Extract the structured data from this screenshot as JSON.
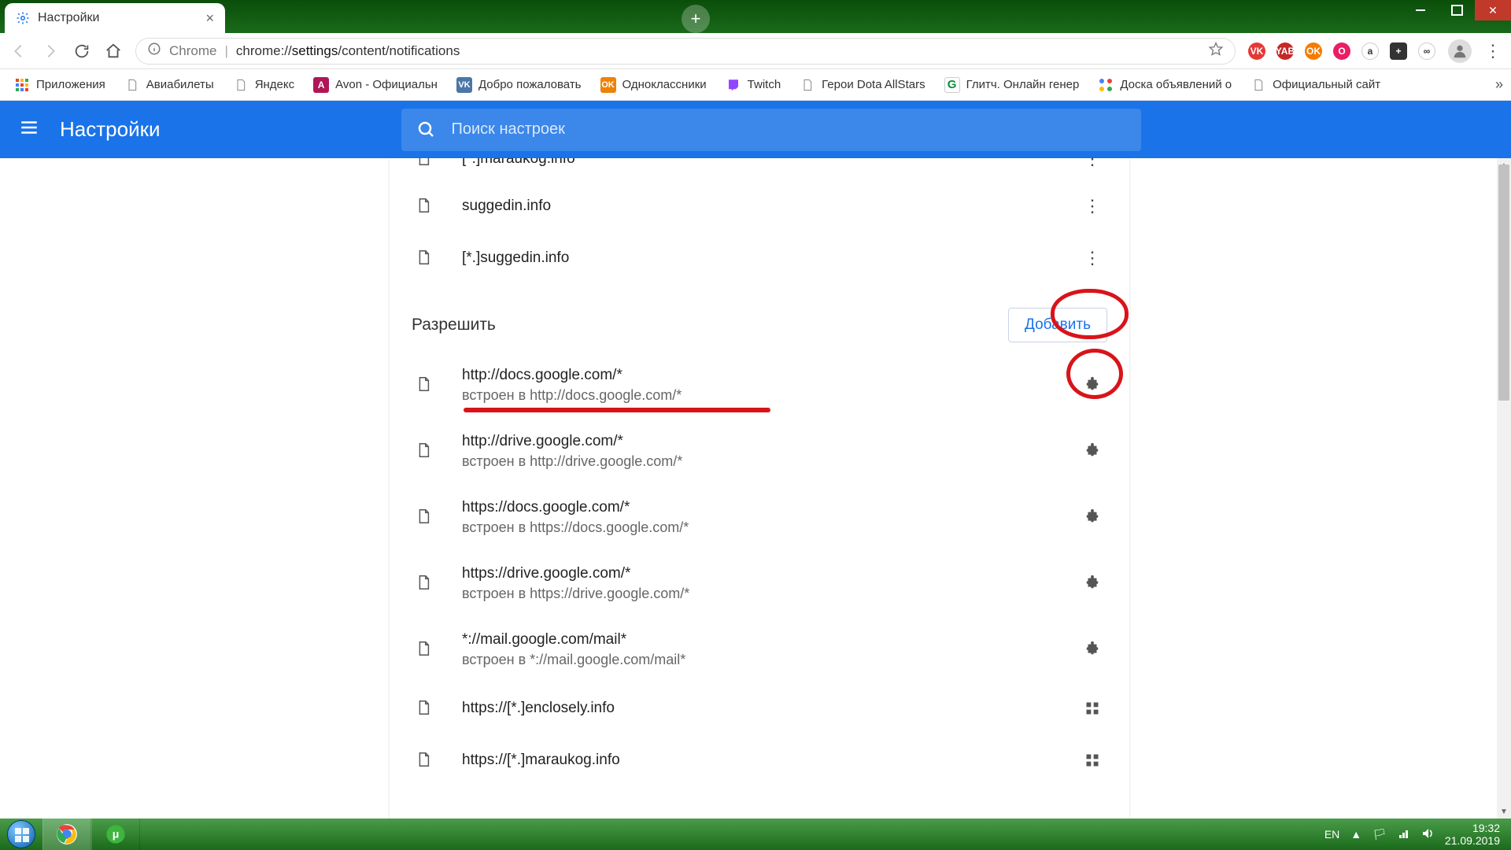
{
  "tab": {
    "title": "Настройки"
  },
  "omnibox": {
    "prefix": "Chrome",
    "url_prefix": "chrome://",
    "url_bold": "settings",
    "url_rest": "/content/notifications"
  },
  "bookmarks": [
    {
      "label": "Приложения",
      "icon": "apps"
    },
    {
      "label": "Авиабилеты",
      "icon": "page"
    },
    {
      "label": "Яндекс",
      "icon": "page"
    },
    {
      "label": "Avon - Официальн",
      "icon": "avon"
    },
    {
      "label": "Добро пожаловать",
      "icon": "vk"
    },
    {
      "label": "Одноклассники",
      "icon": "ok"
    },
    {
      "label": "Twitch",
      "icon": "twitch"
    },
    {
      "label": "Герои Dota AllStars",
      "icon": "page"
    },
    {
      "label": "Глитч. Онлайн генер",
      "icon": "g"
    },
    {
      "label": "Доска объявлений о",
      "icon": "dots"
    },
    {
      "label": "Официальный сайт",
      "icon": "page"
    }
  ],
  "settings_header": {
    "title": "Настройки",
    "search_placeholder": "Поиск настроек"
  },
  "blocked_items": [
    {
      "title": "[*.]maraukog.info"
    },
    {
      "title": "suggedin.info"
    },
    {
      "title": "[*.]suggedin.info"
    }
  ],
  "allow_section": {
    "title": "Разрешить",
    "add_label": "Добавить"
  },
  "allow_items": [
    {
      "title": "http://docs.google.com/*",
      "sub": "встроен в http://docs.google.com/*",
      "icon": "puzzle"
    },
    {
      "title": "http://drive.google.com/*",
      "sub": "встроен в http://drive.google.com/*",
      "icon": "puzzle"
    },
    {
      "title": "https://docs.google.com/*",
      "sub": "встроен в https://docs.google.com/*",
      "icon": "puzzle"
    },
    {
      "title": "https://drive.google.com/*",
      "sub": "встроен в https://drive.google.com/*",
      "icon": "puzzle"
    },
    {
      "title": "*://mail.google.com/mail*",
      "sub": "встроен в *://mail.google.com/mail*",
      "icon": "puzzle"
    },
    {
      "title": "https://[*.]enclosely.info",
      "sub": "",
      "icon": "grid"
    },
    {
      "title": "https://[*.]maraukog.info",
      "sub": "",
      "icon": "grid"
    }
  ],
  "tray": {
    "lang": "EN",
    "time": "19:32",
    "date": "21.09.2019"
  }
}
